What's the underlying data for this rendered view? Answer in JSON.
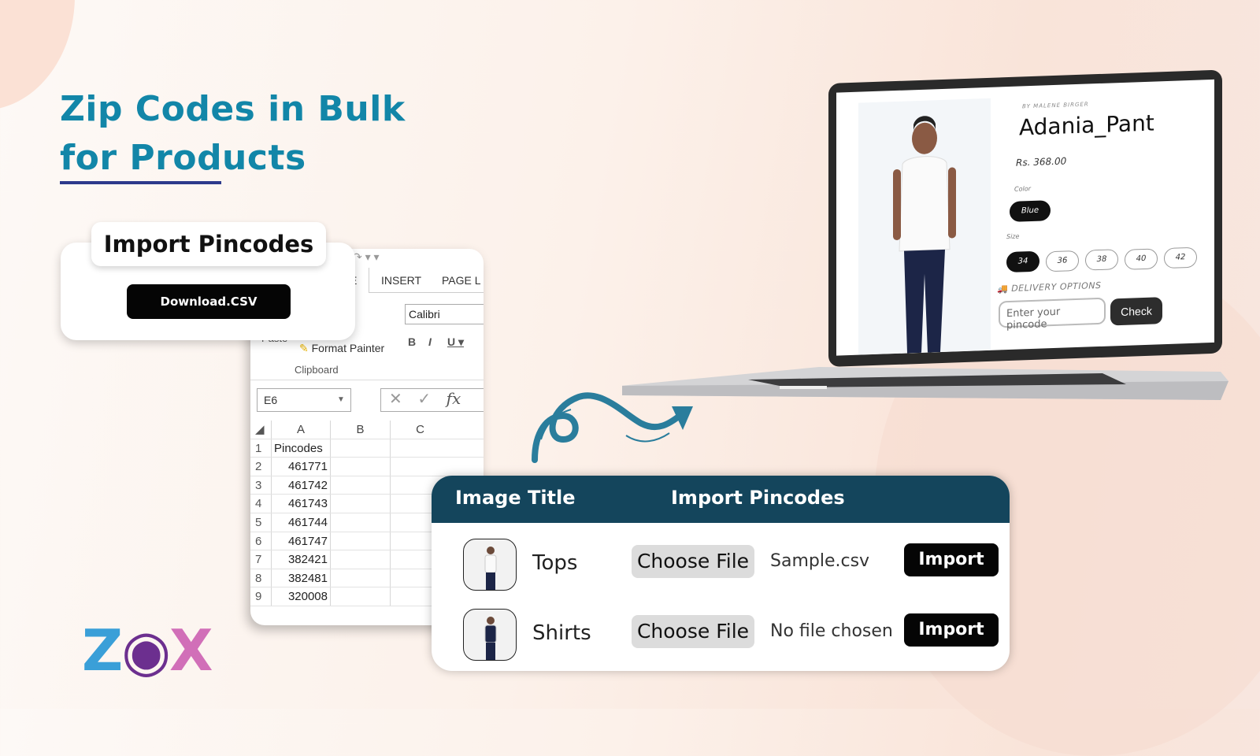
{
  "headline": {
    "line1": "Zip Codes in Bulk",
    "line2": "for Products"
  },
  "import_card": {
    "title": "Import Pincodes",
    "download_label": "Download.CSV"
  },
  "excel": {
    "quick_access": "↷ ▾ ▾",
    "tabs": [
      "E",
      "INSERT",
      "PAGE L"
    ],
    "font_name": "Calibri",
    "bold": "B",
    "italic": "I",
    "underline": "U ▾",
    "paste": "Paste",
    "format_painter": "Format Painter",
    "clipboard": "Clipboard",
    "name_box": "E6",
    "formula_icons": {
      "cancel": "✕",
      "enter": "✓",
      "fx": "fx"
    },
    "columns": [
      "A",
      "B",
      "C"
    ],
    "rows": [
      {
        "n": "1",
        "a": "Pincodes"
      },
      {
        "n": "2",
        "a": "461771"
      },
      {
        "n": "3",
        "a": "461742"
      },
      {
        "n": "4",
        "a": "461743"
      },
      {
        "n": "5",
        "a": "461744"
      },
      {
        "n": "6",
        "a": "461747"
      },
      {
        "n": "7",
        "a": "382421"
      },
      {
        "n": "8",
        "a": "382481"
      },
      {
        "n": "9",
        "a": "320008"
      }
    ]
  },
  "product": {
    "brand": "BY MALENE BIRGER",
    "name": "Adania_Pant",
    "price": "Rs. 368.00",
    "color_label": "Color",
    "color_selected": "Blue",
    "size_label": "Size",
    "sizes": [
      "34",
      "36",
      "38",
      "40",
      "42"
    ],
    "size_selected": "34",
    "delivery_label": "DELIVERY OPTIONS",
    "pincode_placeholder": "Enter your pincode",
    "check_label": "Check"
  },
  "table": {
    "headers": [
      "Image  Title",
      "Import Pincodes"
    ],
    "rows": [
      {
        "title": "Tops",
        "choose_label": "Choose File",
        "file": "Sample.csv",
        "import_label": "Import"
      },
      {
        "title": "Shirts",
        "choose_label": "Choose File",
        "file": "No file chosen",
        "import_label": "Import"
      }
    ]
  },
  "logo": {
    "text": "ZOX"
  },
  "colors": {
    "headline": "#1286a8",
    "table_header": "#14455c",
    "arrow": "#2a7d9c"
  }
}
